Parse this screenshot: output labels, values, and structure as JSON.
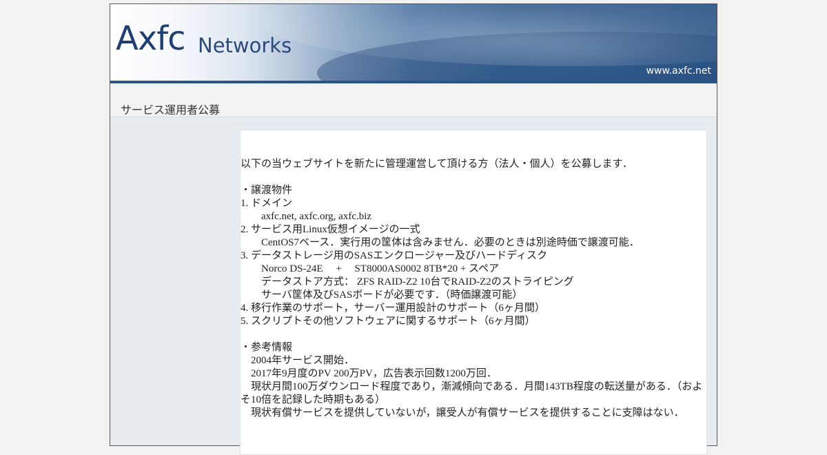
{
  "banner": {
    "logo_main": "Axfc",
    "logo_sub": "Networks",
    "url": "www.axfc.net"
  },
  "page_title": "サービス運用者公募",
  "body": {
    "intro": "以下の当ウェブサイトを新たに管理運営して頂ける方（法人・個人）を公募します．",
    "transfer_heading": "・譲渡物件",
    "item1": "1. ドメイン",
    "item1_detail": "　　axfc.net, axfc.org, axfc.biz",
    "item2": "2. サービス用Linux仮想イメージの一式",
    "item2_detail": "　　CentOS7ベース．実行用の筐体は含みません．必要のときは別途時価で譲渡可能．",
    "item3": "3. データストレージ用のSASエンクロージャー及びハードディスク",
    "item3_detail1": "　　Norco DS-24E　 +　 ST8000AS0002 8TB*20 + スペア",
    "item3_detail2": "　　データストア方式： ZFS RAID-Z2 10台でRAID-Z2のストライピング",
    "item3_detail3": "　　サーバ筐体及びSASボードが必要です．（時価譲渡可能）",
    "item4": "4. 移行作業のサポート，サーバー運用設計のサポート（6ヶ月間）",
    "item5": "5. スクリプトその他ソフトウェアに関するサポート（6ヶ月間）",
    "ref_heading": "・参考情報",
    "ref1": "　2004年サービス開始．",
    "ref2": "　2017年9月度のPV 200万PV，広告表示回数1200万回．",
    "ref3": "　現状月間100万ダウンロード程度であり，漸減傾向である．月間143TB程度の転送量がある．（およそ10倍を記録した時期もある）",
    "ref4": "　現状有償サービスを提供していないが，譲受人が有償サービスを提供することに支障はない．"
  },
  "colors": {
    "banner_blue": "#2d5788",
    "logo_navy": "#1f3f72",
    "page_bg": "#f2f2f2",
    "side_bg": "#e7ecf1"
  }
}
